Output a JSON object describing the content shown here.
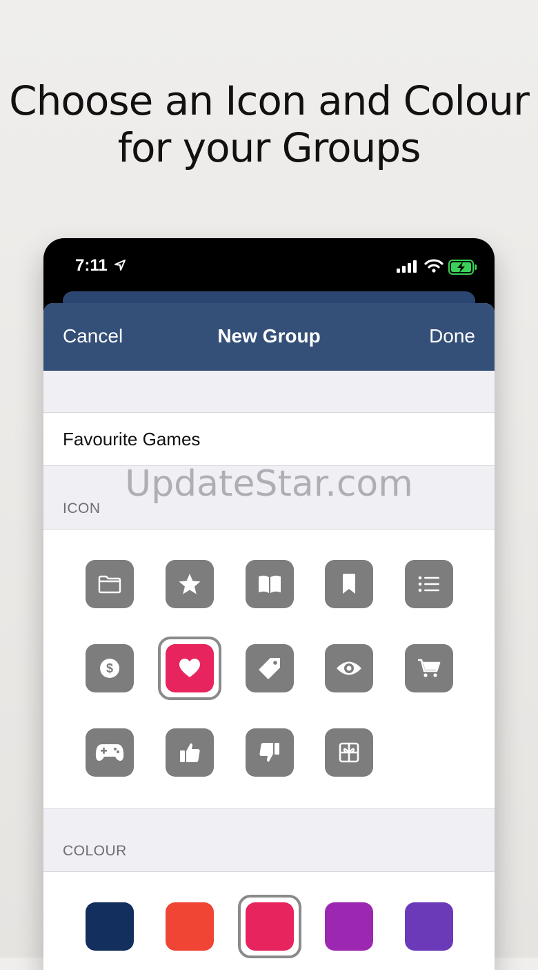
{
  "headline": {
    "line1": "Choose an Icon and Colour",
    "line2": "for your Groups"
  },
  "status_bar": {
    "time": "7:11",
    "icons": [
      "location-arrow-icon",
      "signal-icon",
      "wifi-icon",
      "battery-charging-icon"
    ]
  },
  "nav": {
    "cancel": "Cancel",
    "title": "New Group",
    "done": "Done"
  },
  "group_name": {
    "value": "Favourite Games",
    "placeholder": ""
  },
  "watermark": "UpdateStar.com",
  "icon_section": {
    "label": "ICON",
    "selected": "heart",
    "icons": [
      "folder",
      "star",
      "book",
      "bookmark",
      "list",
      "dollar",
      "heart",
      "tag",
      "eye",
      "cart",
      "gamepad",
      "thumbs-up",
      "thumbs-down",
      "gift"
    ]
  },
  "colour_section": {
    "label": "COLOUR",
    "selected_index": 2,
    "colours": [
      "#122f5e",
      "#f04535",
      "#e8245e",
      "#9c27b0",
      "#6a3ab8"
    ]
  },
  "colors": {
    "nav_bar": "#344f78",
    "tile_gray": "#7d7d7d",
    "selected_accent": "#e8245e"
  }
}
